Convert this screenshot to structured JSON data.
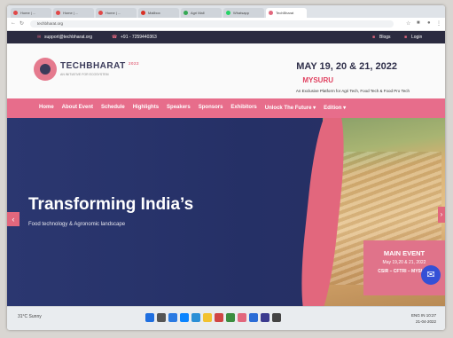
{
  "browser": {
    "tabs": [
      {
        "label": "Home | ...",
        "color": "#e04848"
      },
      {
        "label": "Home | ...",
        "color": "#e04848"
      },
      {
        "label": "Home | ...",
        "color": "#e04848"
      },
      {
        "label": "Mailbox",
        "color": "#d93025"
      },
      {
        "label": "Agri Mall",
        "color": "#34a853"
      },
      {
        "label": "Whatsapp",
        "color": "#25d366"
      },
      {
        "label": "TechBharat",
        "color": "#e2677d"
      }
    ],
    "url": "techbharat.org"
  },
  "topbar": {
    "email": "support@techbharat.org",
    "phone": "+91 - 7259440363",
    "blogs": "Blogs",
    "login": "Login"
  },
  "header": {
    "brand": "TECHBHARAT",
    "brand_year": "2022",
    "brand_tagline": "AN INITIATIVE FOR ECOSYSTEM",
    "dates": "MAY 19, 20 & 21, 2022",
    "city": "MYSURU",
    "tagline": "An Exclusive Platform for Agri Tech, Food Tech & Food Pro Tech"
  },
  "menu": {
    "items": [
      "Home",
      "About Event",
      "Schedule",
      "Highlights",
      "Speakers",
      "Sponsors",
      "Exhibitors",
      "Unlock The Future ▾",
      "Edition ▾"
    ]
  },
  "hero": {
    "title": "Transforming India’s",
    "subtitle": "Food technology & Agronomic landscape",
    "event_title": "MAIN EVENT",
    "event_dates": "May 19,20 & 21, 2022",
    "event_venue": "CSIR – CFTRI – MYSURU"
  },
  "taskbar": {
    "weather": "31°C Sunny",
    "icon_colors": [
      "#1f6fe0",
      "#555",
      "#2a7ae2",
      "#0a84ff",
      "#2b8fd6",
      "#f2c230",
      "#d04545",
      "#3c8d40",
      "#e2677d",
      "#2b6cd6",
      "#3b3b8f",
      "#444"
    ],
    "lang": "ENG IN",
    "time": "10:27",
    "date": "21-04-2022"
  }
}
